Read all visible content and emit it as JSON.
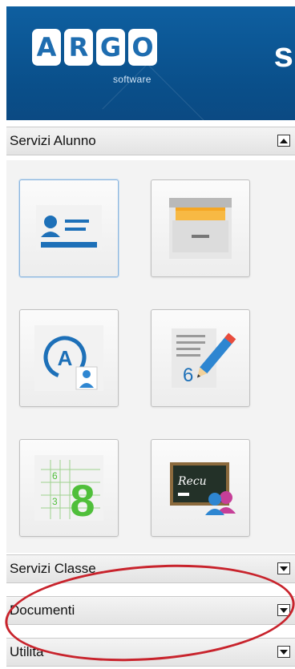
{
  "header": {
    "logo_letters": [
      "A",
      "R",
      "G",
      "O"
    ],
    "logo_sub": "software",
    "title_cut": "s"
  },
  "panels": {
    "servizi_alunno": {
      "label": "Servizi Alunno"
    },
    "servizi_classe": {
      "label": "Servizi Classe"
    },
    "documenti": {
      "label": "Documenti"
    },
    "utilita": {
      "label": "Utilita"
    }
  },
  "tiles": {
    "blackboard_text": "Recu",
    "grade_big": "8",
    "grade_small_top": "6",
    "grade_small_mid": "3",
    "grade_pencil": "6"
  },
  "colors": {
    "header_blue": "#0a4f8a",
    "accent_blue": "#1d70b8",
    "green": "#4fbf3a",
    "annotation_red": "#c8232c"
  }
}
